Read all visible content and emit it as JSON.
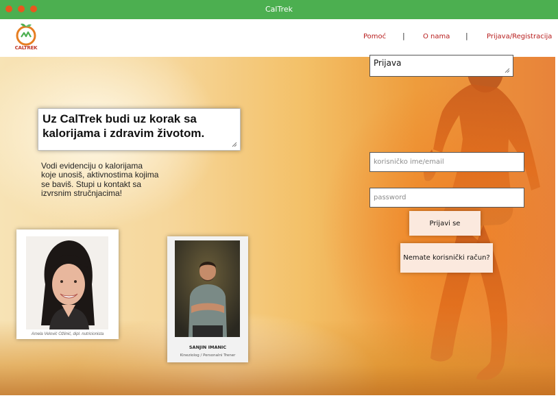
{
  "window": {
    "title": "CalTrek"
  },
  "header": {
    "logo_text": "CALTREK",
    "nav": [
      {
        "label": "Pomoć"
      },
      {
        "label": "O nama"
      },
      {
        "label": "Prijava/Registracija"
      }
    ],
    "separator": "|"
  },
  "hero": {
    "heading": "Uz CalTrek budi uz korak sa kalorijama i zdravim životom.",
    "intro": "Vodi evidenciju o kalorijama koje unosiš,  aktivnostima kojima se baviš. Stupi u kontakt sa izvrsnim stručnjacima!"
  },
  "experts": [
    {
      "caption": "Amela Velović Ožlinić, dipl. nutricionista"
    },
    {
      "name": "SANJIN IMANIC",
      "role": "Kineziolog / Personalni Trener"
    }
  ],
  "login": {
    "title": "Prijava",
    "username_placeholder": "korisničko ime/email",
    "password_placeholder": "password",
    "submit_label": "Prijavi se",
    "register_label": "Nemate korisnički račun?"
  },
  "colors": {
    "titlebar": "#4caf50",
    "traffic_lights": "#e8571e",
    "nav_link": "#b71c1c",
    "button_bg": "#fbe9de"
  }
}
